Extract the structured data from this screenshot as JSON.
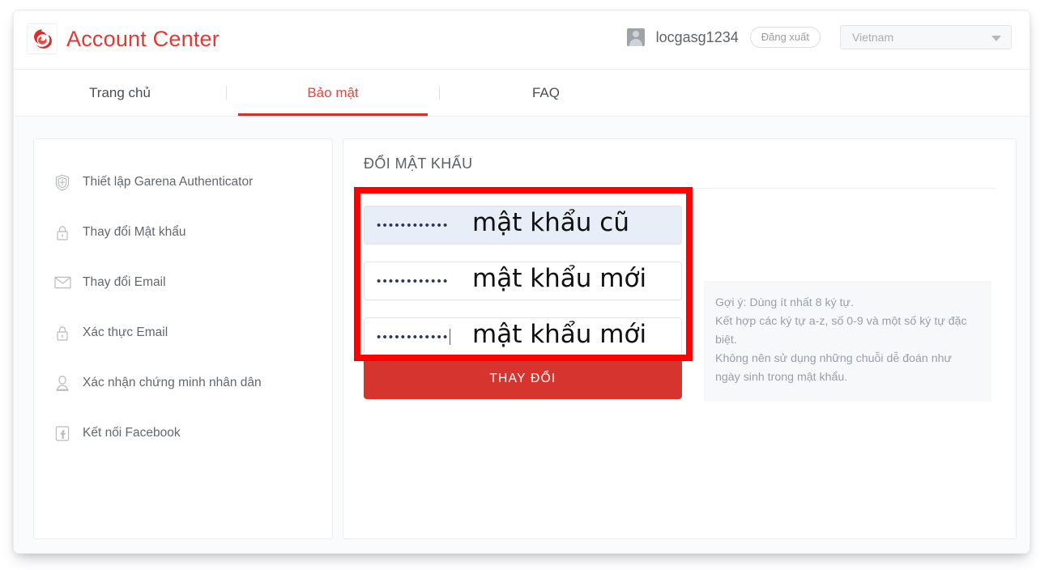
{
  "header": {
    "brand_title": "Account Center",
    "logo_icon": "garena-logo-icon",
    "username": "locgasg1234",
    "logout_label": "Đăng xuất",
    "region_value": "Vietnam",
    "caret_icon": "chevron-down-icon",
    "avatar_icon": "user-avatar-icon",
    "brand_color": "#e03a33"
  },
  "tabs": [
    {
      "label": "Trang chủ",
      "active": false
    },
    {
      "label": "Bảo mật",
      "active": true
    },
    {
      "label": "FAQ",
      "active": false
    }
  ],
  "sidebar": {
    "items": [
      {
        "label": "Thiết lập Garena Authenticator",
        "icon": "shield-icon"
      },
      {
        "label": "Thay đổi Mật khẩu",
        "icon": "lock-icon"
      },
      {
        "label": "Thay đổi Email",
        "icon": "envelope-icon"
      },
      {
        "label": "Xác thực Email",
        "icon": "lock-icon"
      },
      {
        "label": "Xác nhận chứng minh nhân dân",
        "icon": "id-person-icon"
      },
      {
        "label": "Kết nối Facebook",
        "icon": "facebook-icon"
      }
    ]
  },
  "content": {
    "title": "ĐỔI MẬT KHẨU",
    "fields": [
      {
        "name": "current-password",
        "masked_value": "••••••••••••",
        "autofilled": true,
        "focused": false
      },
      {
        "name": "new-password",
        "masked_value": "••••••••••••",
        "autofilled": false,
        "focused": false
      },
      {
        "name": "confirm-password",
        "masked_value": "••••••••••••",
        "autofilled": false,
        "focused": true
      }
    ],
    "submit_label": "THAY ĐỔI",
    "submit_color": "#d6352f",
    "hint": {
      "line1": "Gợi ý: Dùng ít nhất 8 ký tự.",
      "line2": "Kết hợp các ký tự a-z, số 0-9 và một số ký tự đặc biệt.",
      "line3": "Không nên sử dụng những chuỗi dễ đoán như ngày sinh trong mật khẩu."
    }
  },
  "annotations": {
    "box_color": "#fe0000",
    "label_old": "mật khẩu cũ",
    "label_new1": "mật khẩu mới",
    "label_new2": "mật khẩu mới"
  }
}
